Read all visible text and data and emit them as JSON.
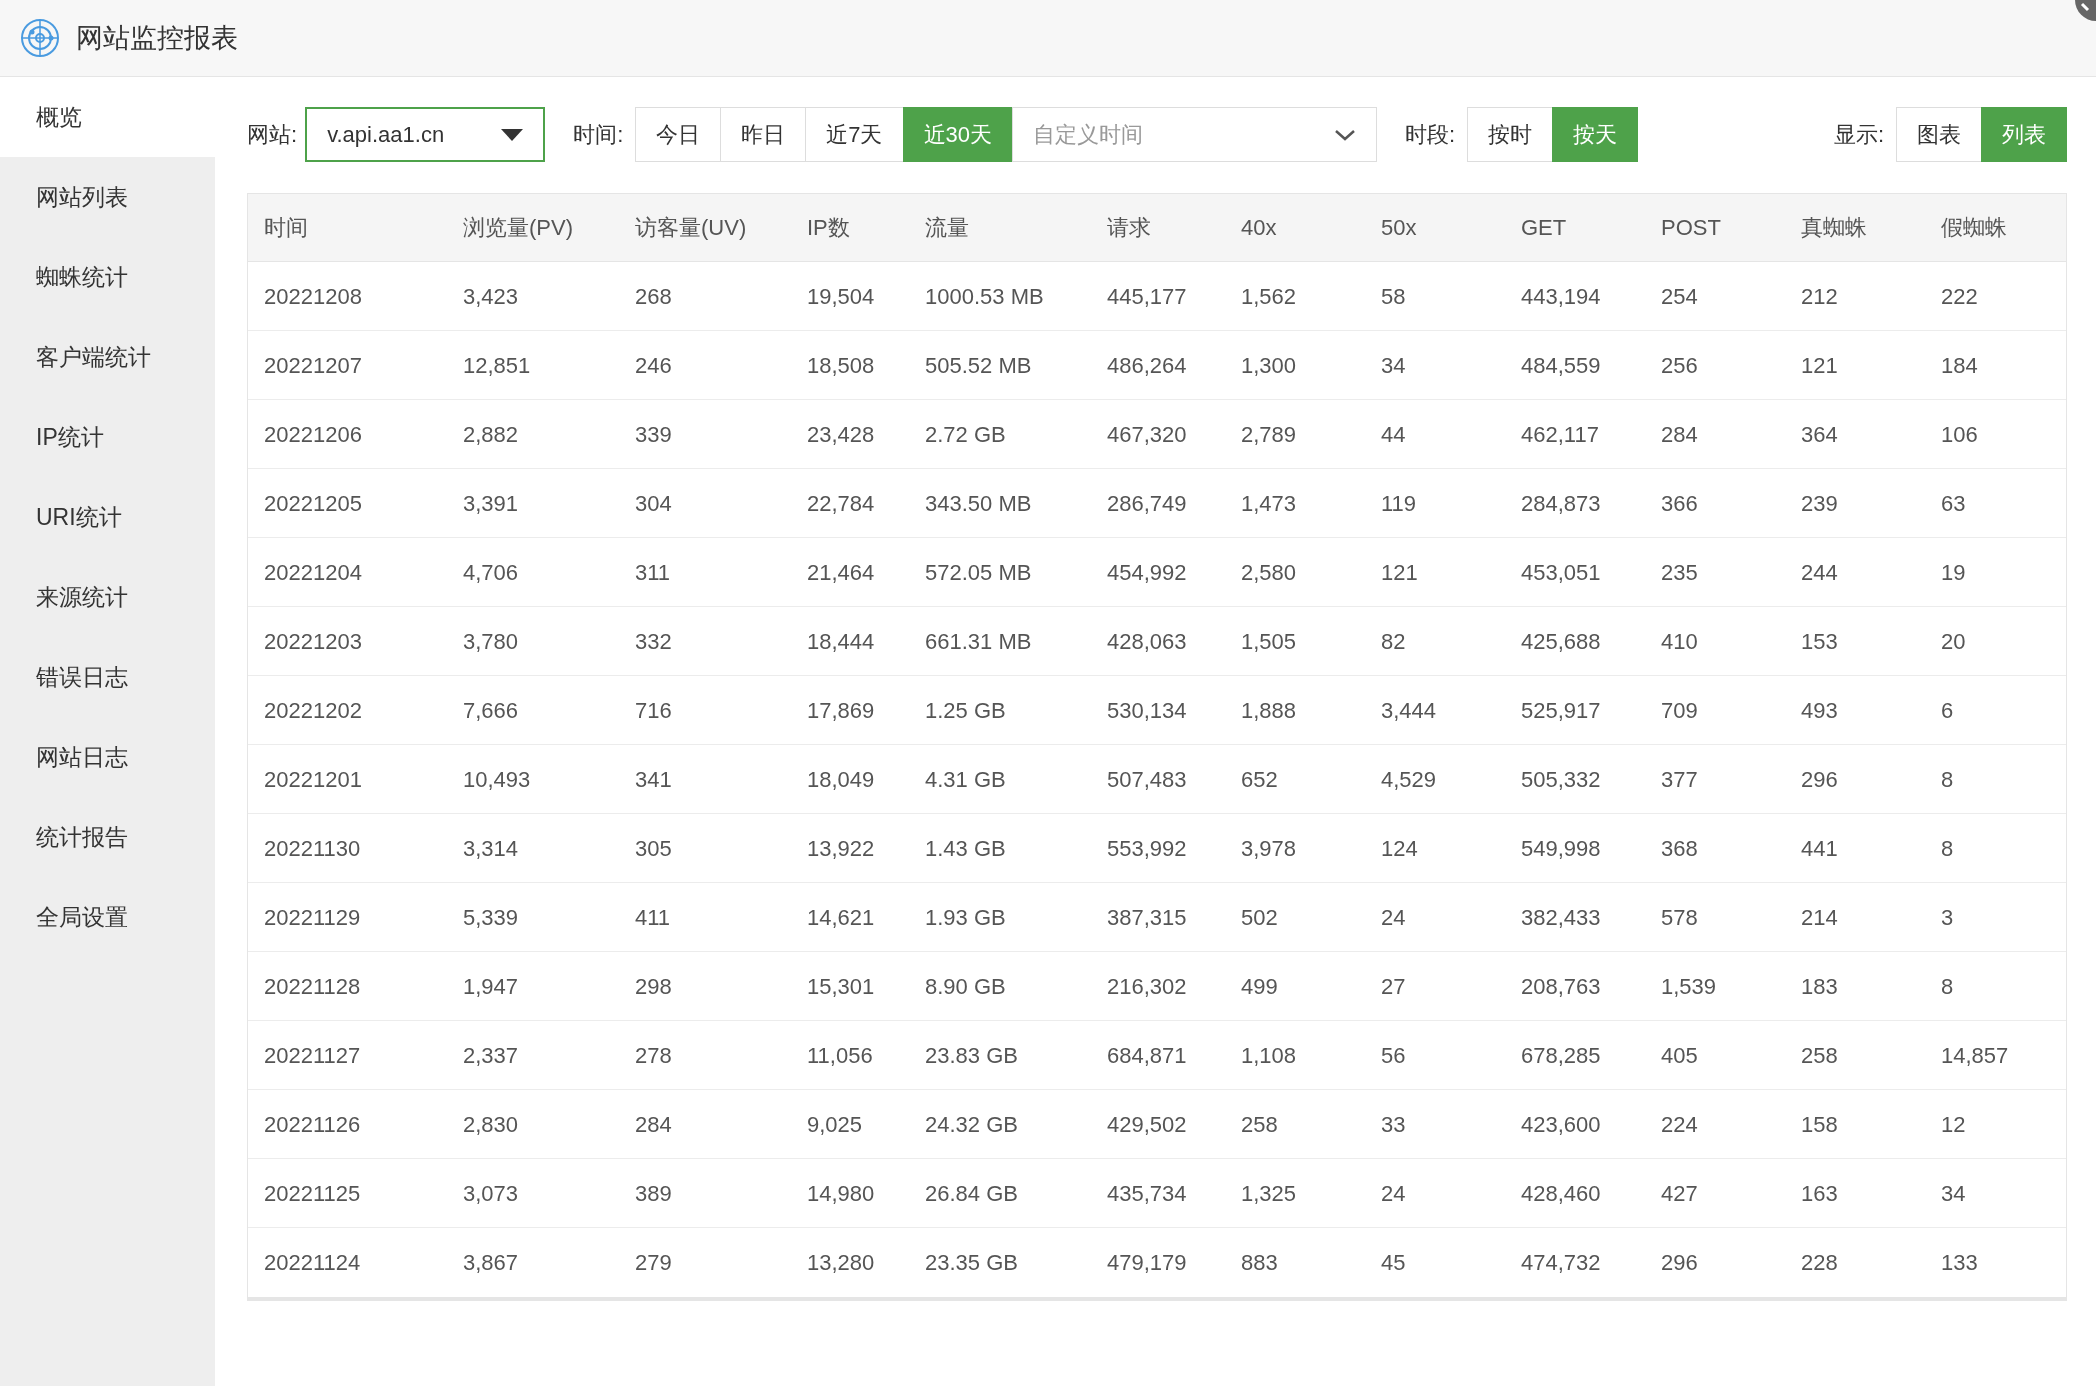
{
  "window": {
    "title": "网站监控报表"
  },
  "sidebar": {
    "items": [
      {
        "label": "概览",
        "selected": true
      },
      {
        "label": "网站列表",
        "selected": false
      },
      {
        "label": "蜘蛛统计",
        "selected": false
      },
      {
        "label": "客户端统计",
        "selected": false
      },
      {
        "label": "IP统计",
        "selected": false
      },
      {
        "label": "URI统计",
        "selected": false
      },
      {
        "label": "来源统计",
        "selected": false
      },
      {
        "label": "错误日志",
        "selected": false
      },
      {
        "label": "网站日志",
        "selected": false
      },
      {
        "label": "统计报告",
        "selected": false
      },
      {
        "label": "全局设置",
        "selected": false
      }
    ]
  },
  "filters": {
    "site": {
      "label": "网站:",
      "value": "v.api.aa1.cn"
    },
    "time": {
      "label": "时间:",
      "options": [
        {
          "label": "今日",
          "selected": false
        },
        {
          "label": "昨日",
          "selected": false
        },
        {
          "label": "近7天",
          "selected": false
        },
        {
          "label": "近30天",
          "selected": true
        }
      ],
      "custom_placeholder": "自定义时间"
    },
    "period": {
      "label": "时段:",
      "options": [
        {
          "label": "按时",
          "selected": false
        },
        {
          "label": "按天",
          "selected": true
        }
      ]
    },
    "display": {
      "label": "显示:",
      "options": [
        {
          "label": "图表",
          "selected": false
        },
        {
          "label": "列表",
          "selected": true
        }
      ]
    }
  },
  "table": {
    "columns": [
      "时间",
      "浏览量(PV)",
      "访客量(UV)",
      "IP数",
      "流量",
      "请求",
      "40x",
      "50x",
      "GET",
      "POST",
      "真蜘蛛",
      "假蜘蛛"
    ],
    "rows": [
      [
        "20221208",
        "3,423",
        "268",
        "19,504",
        "1000.53 MB",
        "445,177",
        "1,562",
        "58",
        "443,194",
        "254",
        "212",
        "222"
      ],
      [
        "20221207",
        "12,851",
        "246",
        "18,508",
        "505.52 MB",
        "486,264",
        "1,300",
        "34",
        "484,559",
        "256",
        "121",
        "184"
      ],
      [
        "20221206",
        "2,882",
        "339",
        "23,428",
        "2.72 GB",
        "467,320",
        "2,789",
        "44",
        "462,117",
        "284",
        "364",
        "106"
      ],
      [
        "20221205",
        "3,391",
        "304",
        "22,784",
        "343.50 MB",
        "286,749",
        "1,473",
        "119",
        "284,873",
        "366",
        "239",
        "63"
      ],
      [
        "20221204",
        "4,706",
        "311",
        "21,464",
        "572.05 MB",
        "454,992",
        "2,580",
        "121",
        "453,051",
        "235",
        "244",
        "19"
      ],
      [
        "20221203",
        "3,780",
        "332",
        "18,444",
        "661.31 MB",
        "428,063",
        "1,505",
        "82",
        "425,688",
        "410",
        "153",
        "20"
      ],
      [
        "20221202",
        "7,666",
        "716",
        "17,869",
        "1.25 GB",
        "530,134",
        "1,888",
        "3,444",
        "525,917",
        "709",
        "493",
        "6"
      ],
      [
        "20221201",
        "10,493",
        "341",
        "18,049",
        "4.31 GB",
        "507,483",
        "652",
        "4,529",
        "505,332",
        "377",
        "296",
        "8"
      ],
      [
        "20221130",
        "3,314",
        "305",
        "13,922",
        "1.43 GB",
        "553,992",
        "3,978",
        "124",
        "549,998",
        "368",
        "441",
        "8"
      ],
      [
        "20221129",
        "5,339",
        "411",
        "14,621",
        "1.93 GB",
        "387,315",
        "502",
        "24",
        "382,433",
        "578",
        "214",
        "3"
      ],
      [
        "20221128",
        "1,947",
        "298",
        "15,301",
        "8.90 GB",
        "216,302",
        "499",
        "27",
        "208,763",
        "1,539",
        "183",
        "8"
      ],
      [
        "20221127",
        "2,337",
        "278",
        "11,056",
        "23.83 GB",
        "684,871",
        "1,108",
        "56",
        "678,285",
        "405",
        "258",
        "14,857"
      ],
      [
        "20221126",
        "2,830",
        "284",
        "9,025",
        "24.32 GB",
        "429,502",
        "258",
        "33",
        "423,600",
        "224",
        "158",
        "12"
      ],
      [
        "20221125",
        "3,073",
        "389",
        "14,980",
        "26.84 GB",
        "435,734",
        "1,325",
        "24",
        "428,460",
        "427",
        "163",
        "34"
      ],
      [
        "20221124",
        "3,867",
        "279",
        "13,280",
        "23.35 GB",
        "479,179",
        "883",
        "45",
        "474,732",
        "296",
        "228",
        "133"
      ]
    ]
  }
}
